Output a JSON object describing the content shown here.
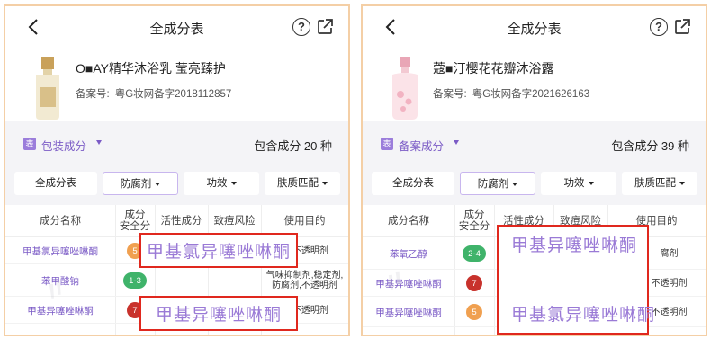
{
  "panels": [
    {
      "nav_title": "全成分表",
      "help_glyph": "?",
      "product_name": "O■AY精华沐浴乳 莹亮臻护",
      "record_label": "备案号:",
      "record_value": "粤G妆网备字2018112857",
      "tag_char": "表",
      "ingredient_kind": "包装成分",
      "total_text": "包含成分 20 种",
      "filters": [
        "全成分表",
        "防腐剂",
        "功效",
        "肤质匹配"
      ],
      "headers": [
        "成分名称",
        "成分\n安全分",
        "活性成分",
        "致痘风险",
        "使用目的"
      ],
      "rows": [
        {
          "name": "甲基氯异噻唑啉酮",
          "score": "5",
          "purpose": "剂,不透明剂"
        },
        {
          "name": "苯甲酸钠",
          "score": "1-3",
          "purpose": "气味抑制剂,稳定剂,\n防腐剂,不透明剂"
        },
        {
          "name": "甲基异噻唑啉酮",
          "score": "7",
          "purpose": "剂,不透明剂"
        }
      ],
      "highlight_top": "甲基氯异噻唑啉酮",
      "highlight_bottom": "甲基异噻唑啉酮"
    },
    {
      "nav_title": "全成分表",
      "help_glyph": "?",
      "product_name": "蔻■汀樱花花瓣沐浴露",
      "record_label": "备案号:",
      "record_value": "粤G妆网备字2021626163",
      "tag_char": "表",
      "ingredient_kind": "备案成分",
      "total_text": "包含成分 39 种",
      "filters": [
        "全成分表",
        "防腐剂",
        "功效",
        "肤质匹配"
      ],
      "headers": [
        "成分名称",
        "成分\n安全分",
        "活性成分",
        "致痘风险",
        "使用目的"
      ],
      "rows": [
        {
          "name": "苯氧乙醇",
          "score": "2-4",
          "purpose": "腐剂"
        },
        {
          "name": "甲基异噻唑啉酮",
          "score": "7",
          "purpose": "不透明剂"
        },
        {
          "name": "甲基异噻唑啉酮",
          "score": "5",
          "purpose": "不透明剂"
        }
      ],
      "highlight_top": "甲基异噻唑啉酮",
      "highlight_bottom": "甲基氯异噻唑啉酮"
    }
  ],
  "colors": {
    "accent": "#7b5bc6",
    "highlight_border": "#e0281e",
    "score_green": "#3fb36a",
    "score_orange": "#f0a050",
    "score_red": "#c8322c"
  }
}
